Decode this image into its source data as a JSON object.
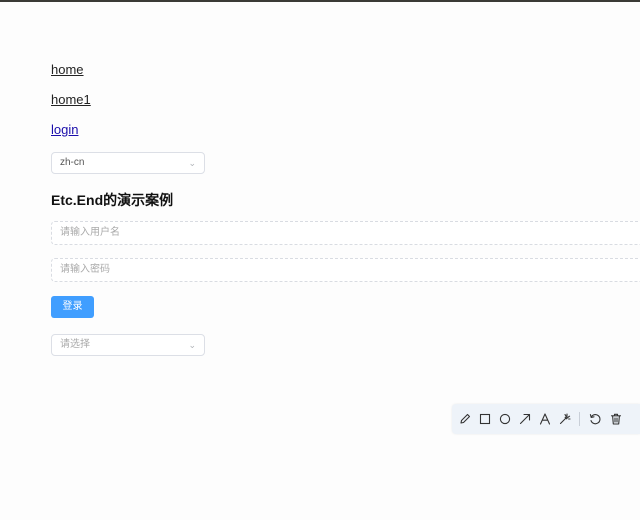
{
  "nav": {
    "home": "home",
    "home1": "home1",
    "login": "login"
  },
  "language_select": {
    "value": "zh-cn"
  },
  "demo": {
    "title": "Etc.End的演示案例"
  },
  "form": {
    "username_placeholder": "请输入用户名",
    "password_placeholder": "请输入密码",
    "login_label": "登录",
    "select_placeholder": "请选择"
  },
  "annotation_toolbar": {
    "tools": [
      "pencil-icon",
      "rectangle-icon",
      "circle-icon",
      "arrow-icon",
      "text-icon",
      "magic-wand-icon",
      "undo-icon",
      "trash-icon"
    ]
  },
  "colors": {
    "primary_button": "#409eff",
    "visited_link": "#1a0dab",
    "toolbar_bg": "#eef3f9"
  }
}
